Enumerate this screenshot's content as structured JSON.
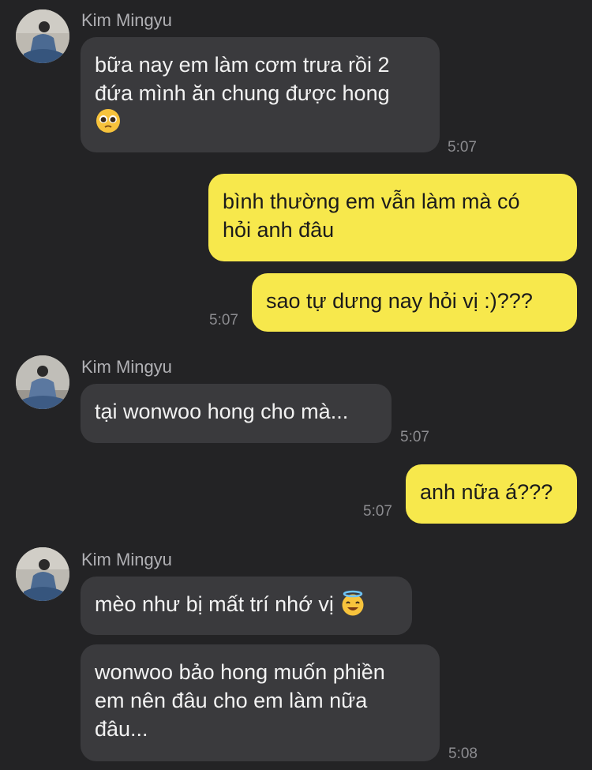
{
  "groups": [
    {
      "sender": "Kim Mingyu",
      "messages": [
        {
          "text": "bữa nay em làm cơm trưa rồi 2\nđứa mình ăn chung được hong",
          "emoji": "pleading-face-icon",
          "time": "5:07"
        }
      ]
    },
    {
      "sender": "me",
      "messages": [
        {
          "text": "bình thường em vẫn làm mà có\nhỏi anh đâu"
        },
        {
          "text": "sao tự dưng nay hỏi vị :)???",
          "time": "5:07"
        }
      ]
    },
    {
      "sender": "Kim Mingyu",
      "messages": [
        {
          "text": "tại wonwoo hong cho mà...",
          "time": "5:07"
        }
      ]
    },
    {
      "sender": "me",
      "messages": [
        {
          "text": "anh nữa á???",
          "time": "5:07"
        }
      ]
    },
    {
      "sender": "Kim Mingyu",
      "messages": [
        {
          "text": "mèo như bị mất trí nhớ vị",
          "emoji": "smiling-face-with-halo-icon"
        },
        {
          "text": "wonwoo bảo hong muốn phiền\nem nên đâu cho em làm nữa\nđâu...",
          "time": "5:08"
        }
      ]
    }
  ],
  "colors": {
    "background": "#232325",
    "incoming_bubble": "#3a3a3d",
    "outgoing_bubble": "#f7e84c",
    "sender_text": "#b0b0b4",
    "timestamp": "#8c8c90"
  }
}
